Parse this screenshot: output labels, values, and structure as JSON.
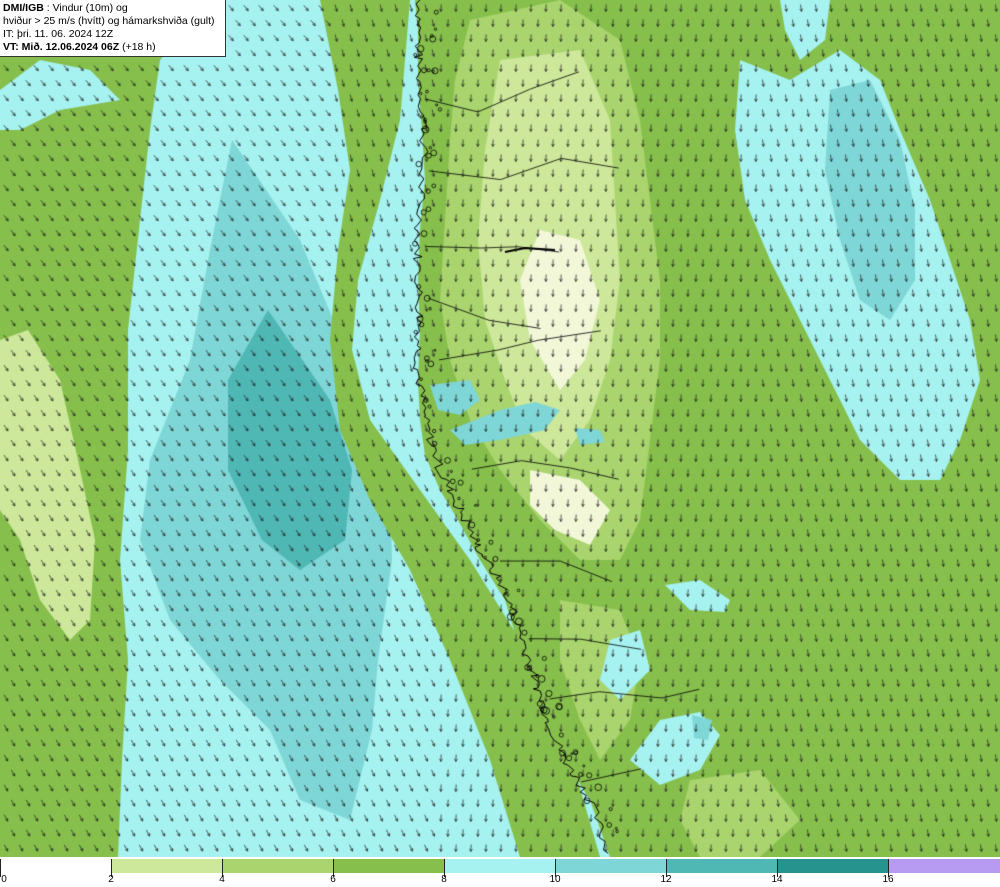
{
  "info": {
    "org": "DMI/IGB",
    "title_rest": " : Vindur (10m) og",
    "line2": "hviður > 25 m/s (hvítt) og hámarkshviða (gult)",
    "line3": "IT: þri. 11. 06. 2024 12Z",
    "vt_label": "VT: Mið. 12.06.2024 06Z",
    "vt_offset": " (+18 h)"
  },
  "legend": {
    "ticks": [
      "0",
      "2",
      "4",
      "6",
      "8",
      "10",
      "12",
      "14",
      "16"
    ],
    "colors": [
      "#ffffff",
      "#cde89a",
      "#a9d46e",
      "#86bf4c",
      "#a6f2f0",
      "#7fd6d6",
      "#4fb7b4",
      "#26938e",
      "#b79bf3"
    ]
  },
  "map": {
    "sea_color": "#a6f2f0",
    "land_color": "#86bf4c",
    "coast_color": "#000000",
    "arrow_color": "#1a1a1a"
  }
}
